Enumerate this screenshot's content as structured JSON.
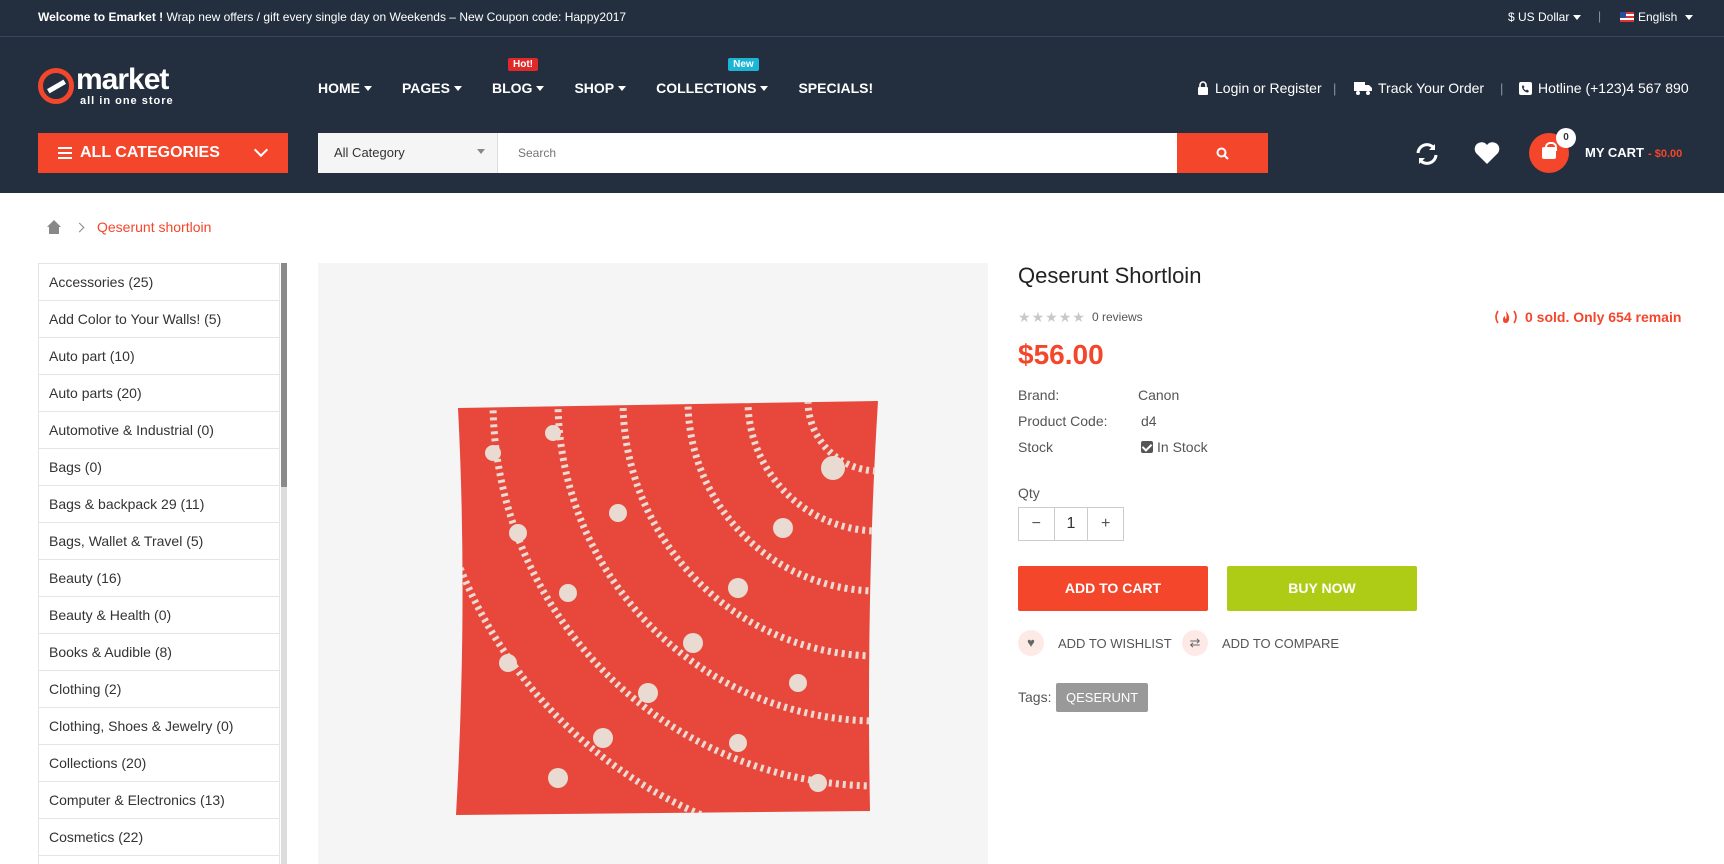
{
  "topbar": {
    "welcome_bold": "Welcome to Emarket !",
    "welcome_rest": " Wrap new offers / gift every single day on Weekends – New Coupon code: Happy2017",
    "currency": "$ US Dollar",
    "divider": "|",
    "language": "English"
  },
  "header": {
    "logo_main": "market",
    "logo_tagline": "all in one store",
    "nav": [
      {
        "label": "HOME"
      },
      {
        "label": "PAGES"
      },
      {
        "label": "BLOG",
        "badge": "Hot!"
      },
      {
        "label": "SHOP"
      },
      {
        "label": "COLLECTIONS",
        "badge": "New"
      },
      {
        "label": "SPECIALS!"
      }
    ],
    "login": "Login or Register",
    "track": "Track Your Order",
    "hotline": "Hotline (+123)4 567 890",
    "divider": "|",
    "all_categories": "ALL CATEGORIES",
    "search_category": "All Category",
    "search_placeholder": "Search",
    "cart_count": "0",
    "cart_label": "MY CART",
    "cart_total": "- $0.00"
  },
  "breadcrumb": {
    "current": "Qeserunt shortloin"
  },
  "categories": [
    "Accessories (25)",
    "Add Color to Your Walls! (5)",
    "Auto part (10)",
    "Auto parts (20)",
    "Automotive & Industrial (0)",
    "Bags (0)",
    "Bags & backpack 29 (11)",
    "Bags, Wallet & Travel (5)",
    "Beauty (16)",
    "Beauty & Health (0)",
    "Books & Audible (8)",
    "Clothing (2)",
    "Clothing, Shoes & Jewelry (0)",
    "Collections (20)",
    "Computer & Electronics (13)",
    "Cosmetics (22)"
  ],
  "product": {
    "title": "Qeserunt Shortloin",
    "rating": 0,
    "reviews": "0 reviews",
    "sold": "0 sold. Only 654 remain",
    "price": "$56.00",
    "brand_label": "Brand:",
    "brand": "Canon",
    "code_label": "Product Code:",
    "code": "d4",
    "stock_label": "Stock",
    "stock": "In Stock",
    "qty_label": "Qty",
    "qty": "1",
    "add_to_cart": "ADD TO CART",
    "buy_now": "BUY NOW",
    "wishlist": "ADD TO WISHLIST",
    "compare": "ADD TO COMPARE",
    "tags_label": "Tags:",
    "tag": "QESERUNT"
  },
  "colors": {
    "accent": "#f4462b",
    "dark": "#232f3e",
    "buy": "#aecb15"
  }
}
